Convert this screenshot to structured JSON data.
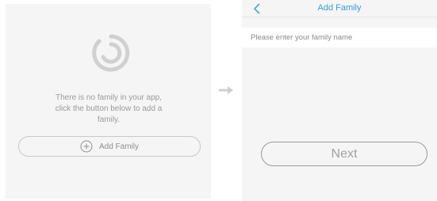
{
  "left_screen": {
    "empty_message": [
      "There is no family in your app,",
      "click the button below to add a",
      "family."
    ],
    "add_button_label": "Add Family",
    "logo_icon": "family-logo-icon",
    "plus_icon": "circle-plus-icon"
  },
  "transition_icon": "right-arrow-icon",
  "right_screen": {
    "title": "Add Family",
    "back_icon": "chevron-left-icon",
    "name_placeholder": "Please enter your family name",
    "next_label": "Next"
  },
  "colors": {
    "accent": "#3a9bdc",
    "panel_bg": "#f5f5f5",
    "muted_text": "#9a9a9a",
    "logo_gray": "#d0d0d0"
  }
}
